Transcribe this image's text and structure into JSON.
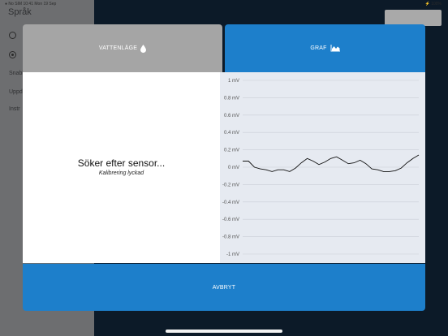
{
  "background": {
    "status_left": "● No SIM  10:41  Mon 19 Sep",
    "status_right": "⚡ 100%",
    "title": "Språk",
    "items": [
      "Snabb",
      "Uppd",
      "Instr"
    ]
  },
  "modal": {
    "tabs": [
      {
        "label": "VATTENLÄGE",
        "icon": "water-drop-icon"
      },
      {
        "label": "GRAF",
        "icon": "area-chart-icon"
      }
    ],
    "status_title": "Söker efter sensor...",
    "status_subtitle": "Kalibrering lyckad",
    "cancel_label": "AVBRYT"
  },
  "colors": {
    "accent": "#1d7fcb",
    "tab_inactive": "#a5a5a5",
    "chart_bg": "#e6eaf1",
    "line": "#111111"
  },
  "chart_data": {
    "type": "line",
    "title": "",
    "xlabel": "",
    "ylabel": "",
    "ylim": [
      -1,
      1
    ],
    "grid": true,
    "yticks": [
      1,
      0.8,
      0.6,
      0.4,
      0.2,
      0,
      -0.2,
      -0.4,
      -0.6,
      -0.8,
      -1
    ],
    "ytick_labels": [
      "1 mV",
      "0.8 mV",
      "0.6 mV",
      "0.4 mV",
      "0.2 mV",
      "0 mV",
      "-0.2 mV",
      "-0.4 mV",
      "-0.6 mV",
      "-0.8 mV",
      "-1 mV"
    ],
    "series": [
      {
        "values": [
          0.07,
          0.07,
          0.0,
          -0.02,
          -0.03,
          -0.05,
          -0.03,
          -0.03,
          -0.05,
          -0.01,
          0.05,
          0.1,
          0.07,
          0.03,
          0.06,
          0.1,
          0.12,
          0.08,
          0.04,
          0.05,
          0.08,
          0.04,
          -0.02,
          -0.03,
          -0.05,
          -0.05,
          -0.04,
          -0.01,
          0.05,
          0.1,
          0.14
        ]
      }
    ]
  }
}
